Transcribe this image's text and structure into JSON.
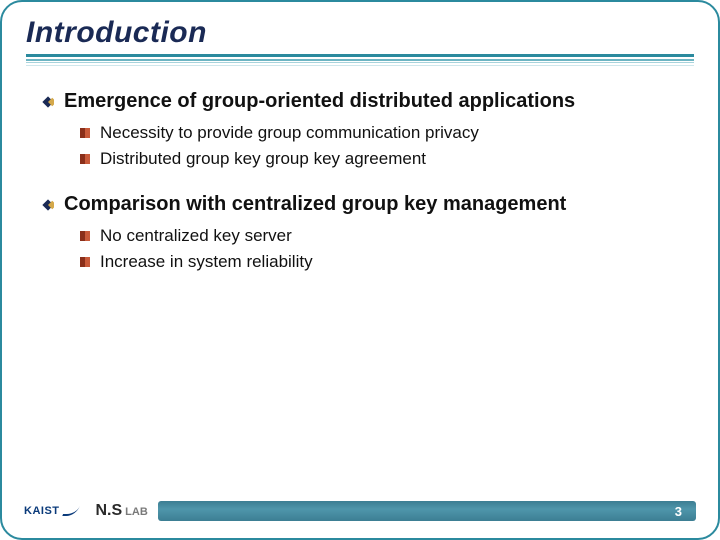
{
  "title": "Introduction",
  "sections": [
    {
      "heading": "Emergence of group-oriented distributed applications",
      "items": [
        "Necessity to provide group communication privacy",
        "Distributed group key group key agreement"
      ]
    },
    {
      "heading": "Comparison with centralized group key management",
      "items": [
        "No centralized key server",
        "Increase in system reliability"
      ]
    }
  ],
  "footer": {
    "org": "KAIST",
    "lab_main": "N.S",
    "lab_sub": "LAB",
    "slide_number": "3"
  },
  "colors": {
    "border": "#2b8a9e",
    "title": "#1a2a55",
    "footer_bar": "#3c7e93"
  }
}
